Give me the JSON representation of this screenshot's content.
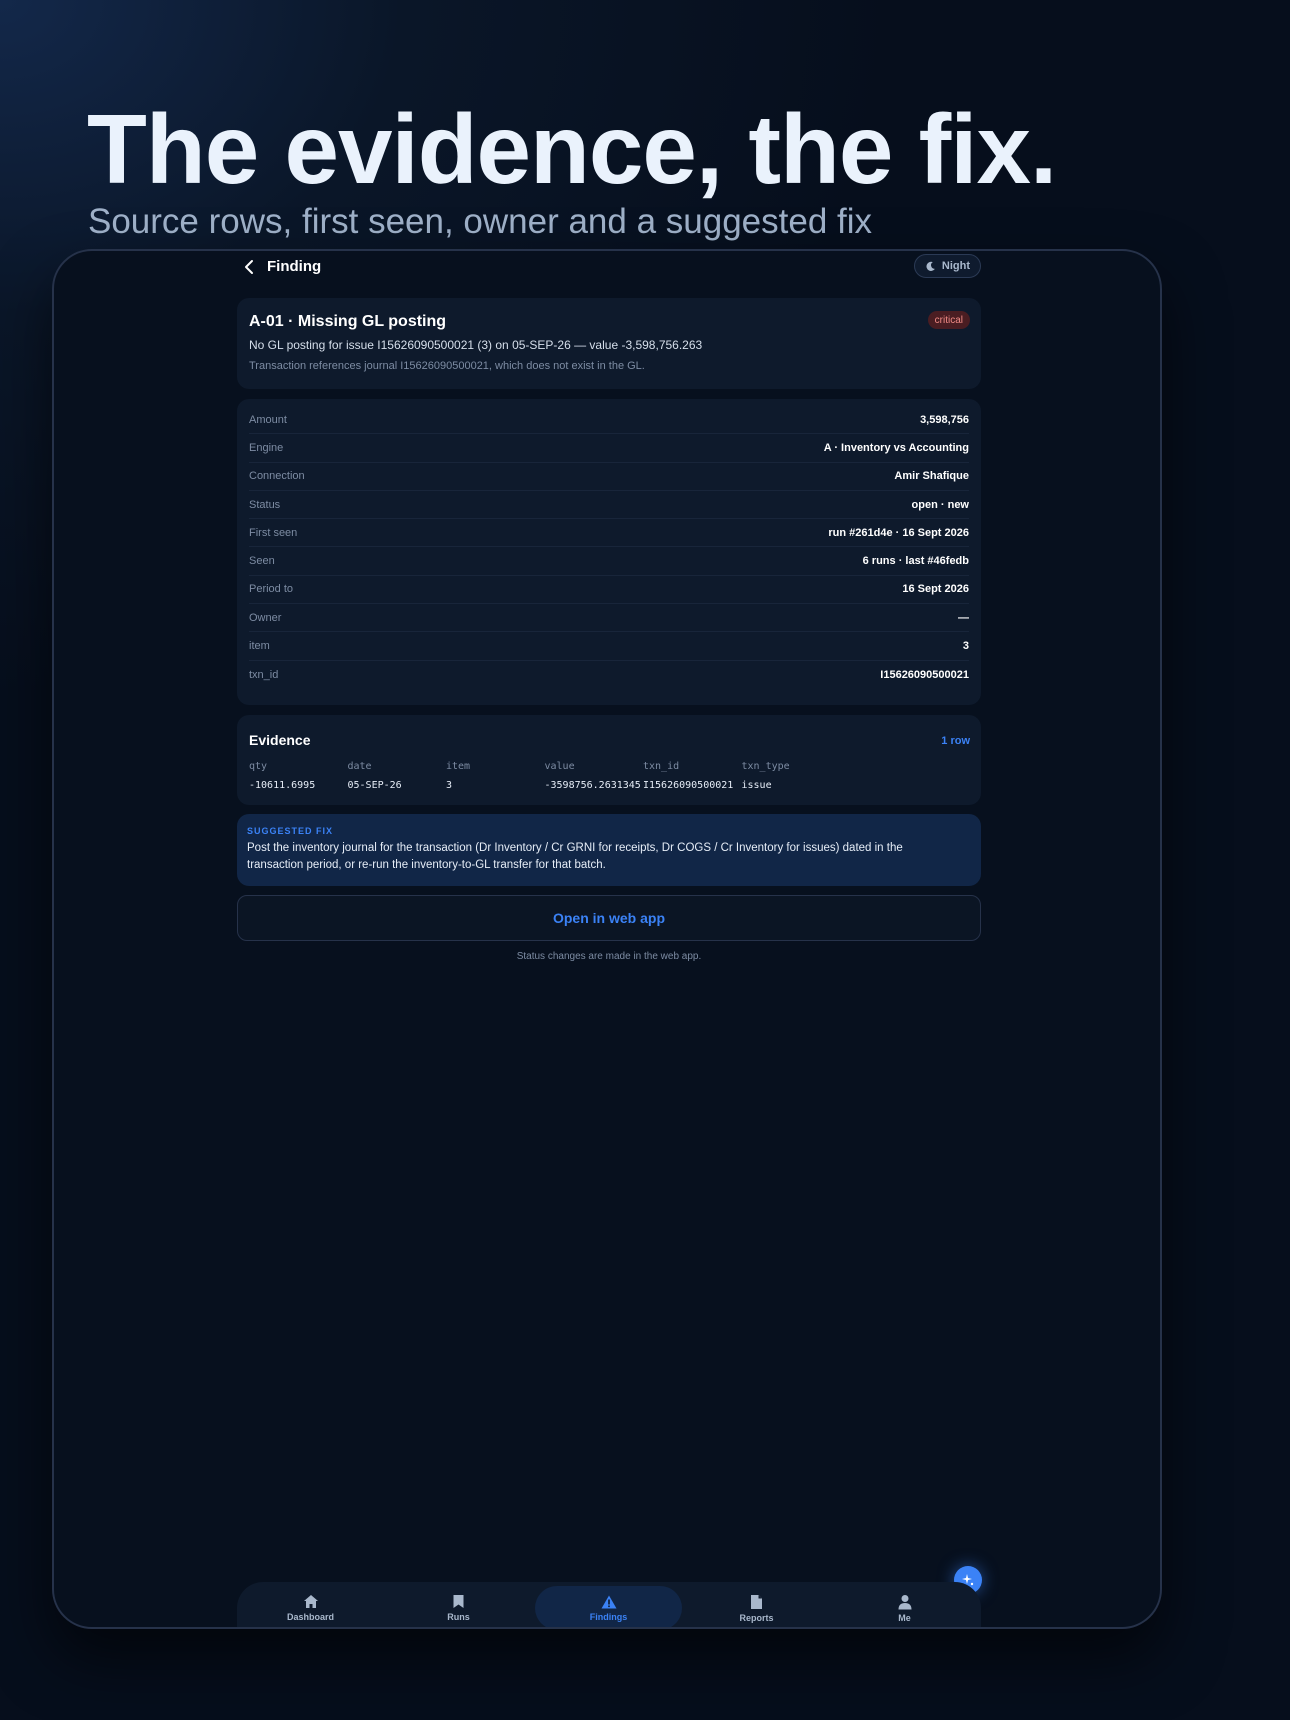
{
  "headline": "The evidence, the fix.",
  "subhead": "Source rows, first seen, owner and a suggested fix",
  "topbar": {
    "title": "Finding",
    "night_label": "Night"
  },
  "finding": {
    "title": "A-01 · Missing GL posting",
    "severity": "critical",
    "summary": "No GL posting for issue I15626090500021 (3) on 05-SEP-26 — value -3,598,756.263",
    "detail": "Transaction references journal I15626090500021, which does not exist in the GL."
  },
  "details": [
    {
      "key": "Amount",
      "value": "3,598,756"
    },
    {
      "key": "Engine",
      "value": "A · Inventory vs Accounting"
    },
    {
      "key": "Connection",
      "value": "Amir Shafique"
    },
    {
      "key": "Status",
      "value": "open · new"
    },
    {
      "key": "First seen",
      "value": "run #261d4e · 16 Sept 2026"
    },
    {
      "key": "Seen",
      "value": "6 runs · last #46fedb"
    },
    {
      "key": "Period to",
      "value": "16 Sept 2026"
    },
    {
      "key": "Owner",
      "value": "—"
    },
    {
      "key": "item",
      "value": "3"
    },
    {
      "key": "txn_id",
      "value": "I15626090500021"
    }
  ],
  "evidence": {
    "title": "Evidence",
    "count_label": "1 row",
    "columns": [
      "qty",
      "date",
      "item",
      "value",
      "txn_id",
      "txn_type"
    ],
    "rows": [
      [
        "-10611.6995",
        "05-SEP-26",
        "3",
        "-3598756.2631345",
        "I15626090500021",
        "issue"
      ]
    ]
  },
  "suggested_fix": {
    "label": "SUGGESTED FIX",
    "text": "Post the inventory journal for the transaction (Dr Inventory / Cr GRNI for receipts, Dr COGS / Cr Inventory for issues) dated in the transaction period, or re-run the inventory-to-GL transfer for that batch."
  },
  "open_button": "Open in web app",
  "note": "Status changes are made in the web app.",
  "nav": {
    "items": [
      {
        "label": "Dashboard",
        "icon": "home-icon"
      },
      {
        "label": "Runs",
        "icon": "bookmark-icon"
      },
      {
        "label": "Findings",
        "icon": "warning-icon"
      },
      {
        "label": "Reports",
        "icon": "document-icon"
      },
      {
        "label": "Me",
        "icon": "person-icon"
      }
    ],
    "active": "Findings"
  },
  "fab_icon": "sparkle-icon",
  "colors": {
    "accent": "#3b82f6",
    "critical_bg": "#4a1d22",
    "critical_text": "#f08b86",
    "card": "#0e1a2c",
    "background": "#07101e"
  }
}
